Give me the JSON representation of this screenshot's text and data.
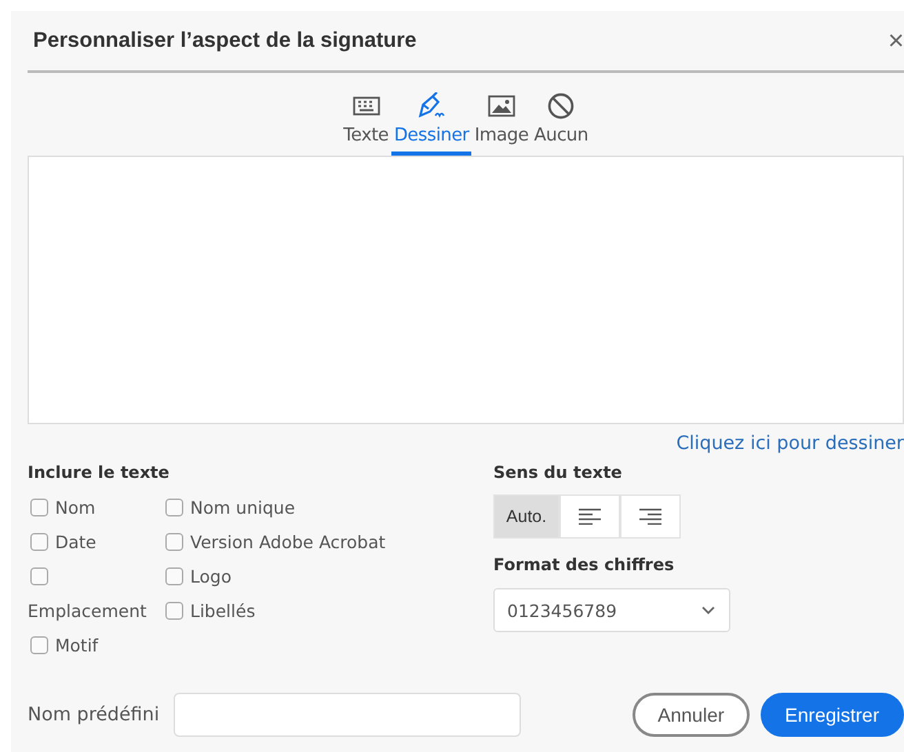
{
  "window": {
    "title": "Personnaliser l’aspect de la signature",
    "close": "×"
  },
  "tabs": [
    {
      "label": "Texte",
      "kind": "keyboard",
      "selected": false
    },
    {
      "label": "Dessiner",
      "kind": "pen",
      "selected": true
    },
    {
      "label": "Image",
      "kind": "image",
      "selected": false
    },
    {
      "label": "Aucun",
      "kind": "none",
      "selected": false
    }
  ],
  "draw_link": "Cliquez ici pour dessiner",
  "include_text": {
    "heading": "Inclure le texte",
    "columns": [
      [
        {
          "label": "Nom",
          "checked": false
        },
        {
          "label": "Date",
          "checked": false
        },
        {
          "label": "Emplacement",
          "checked": false
        },
        {
          "label": "Motif",
          "checked": false
        }
      ],
      [
        {
          "label": "Nom unique",
          "checked": false
        },
        {
          "label": "Version Adobe Acrobat",
          "checked": false
        },
        {
          "label": "Logo",
          "checked": false
        },
        {
          "label": "Libellés",
          "checked": false
        }
      ]
    ]
  },
  "text_direction": {
    "heading": "Sens du texte",
    "options": [
      {
        "kind": "text",
        "label": "Auto.",
        "selected": true
      },
      {
        "kind": "align-left",
        "selected": false
      },
      {
        "kind": "align-right",
        "selected": false
      }
    ]
  },
  "digit_format": {
    "heading": "Format des chiffres",
    "value": "0123456789"
  },
  "preset_name": {
    "label": "Nom prédéfini"
  },
  "buttons": [
    {
      "kind": "secondary",
      "label": "Annuler"
    },
    {
      "kind": "primary",
      "label": "Enregistrer"
    }
  ]
}
